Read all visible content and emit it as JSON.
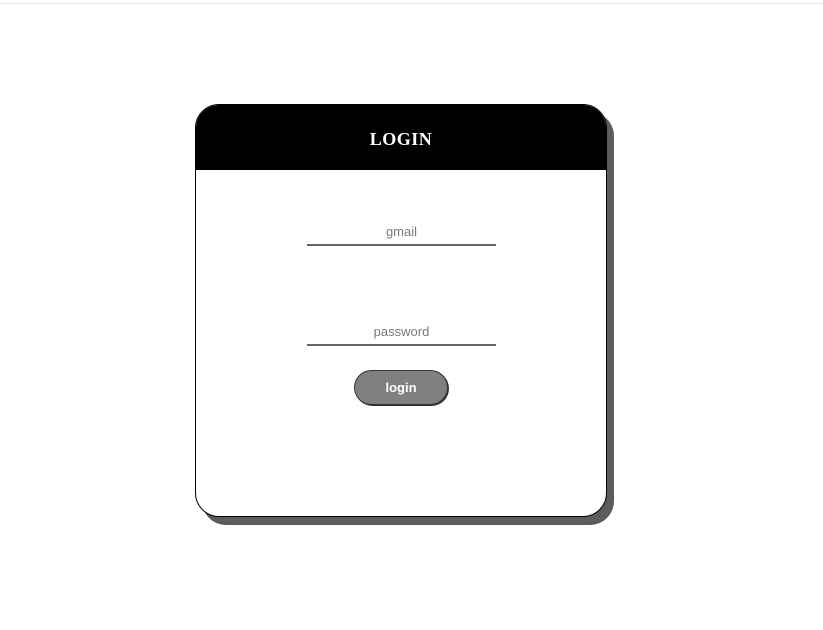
{
  "login_card": {
    "title": "LOGIN",
    "gmail_field": {
      "placeholder": "gmail",
      "value": ""
    },
    "password_field": {
      "placeholder": "password",
      "value": ""
    },
    "submit_label": "login"
  },
  "colors": {
    "header_bg": "#000000",
    "shadow": "#5c5c5c",
    "button_bg": "#808080",
    "field_underline": "#666666"
  }
}
